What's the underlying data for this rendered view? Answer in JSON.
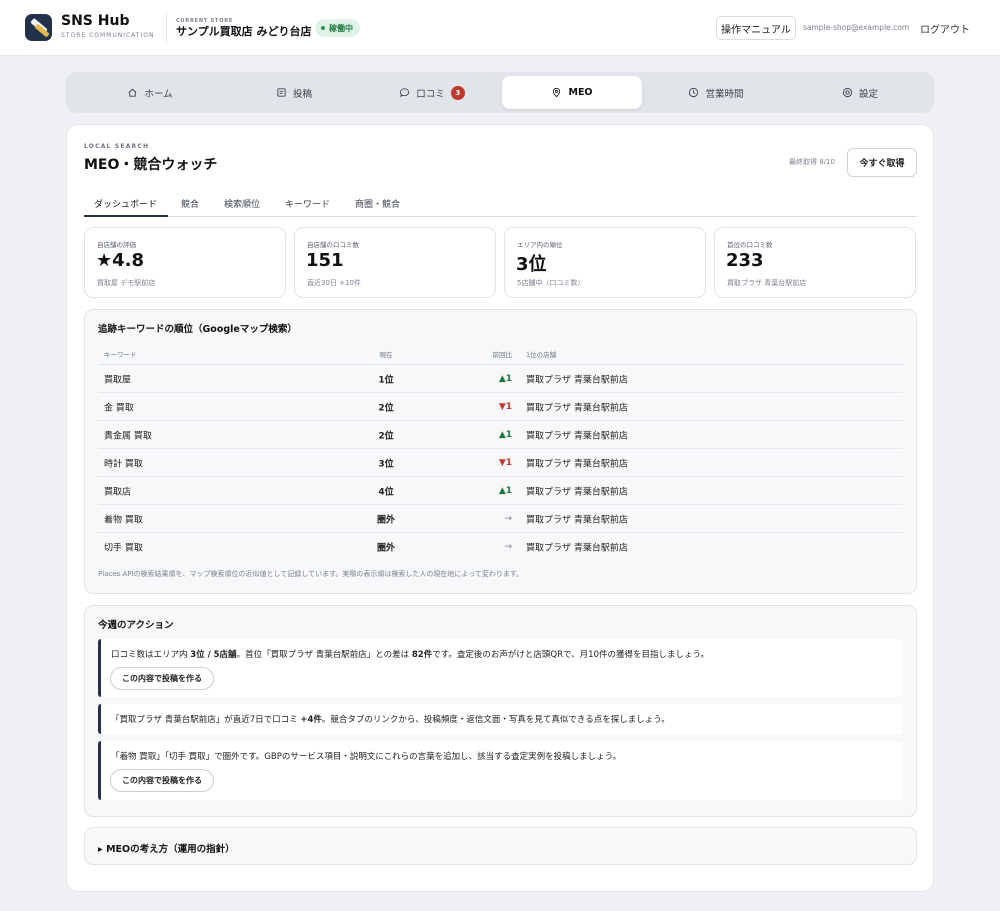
{
  "header": {
    "brand": "SNS Hub",
    "brand_sub": "STORE COMMUNICATION",
    "store_caption": "CURRENT STORE",
    "store_name": "サンプル買取店 みどり台店",
    "status_badge": "稼働中",
    "manual_label": "操作マニュアル",
    "email": "sample-shop@example.com",
    "logout_label": "ログアウト"
  },
  "nav": {
    "tabs": [
      {
        "label": "ホーム",
        "icon": "home-icon"
      },
      {
        "label": "投稿",
        "icon": "edit-icon"
      },
      {
        "label": "口コミ",
        "icon": "chat-icon",
        "badge": "3"
      },
      {
        "label": "MEO",
        "icon": "location-pin-icon",
        "active": true
      },
      {
        "label": "営業時間",
        "icon": "clock-icon"
      },
      {
        "label": "設定",
        "icon": "settings-icon"
      }
    ]
  },
  "page": {
    "eyebrow": "LOCAL SEARCH",
    "title": "MEO・競合ウォッチ",
    "last_fetch": "最終取得 8/10",
    "fetch_button": "今すぐ取得"
  },
  "subtabs": [
    "ダッシュボード",
    "競合",
    "検索順位",
    "キーワード",
    "商圏・競合"
  ],
  "stats": [
    {
      "label": "自店舗の評価",
      "value": "★4.8",
      "sub": "買取屋 デモ駅前店"
    },
    {
      "label": "自店舗の口コミ数",
      "value": "151",
      "sub": "直近30日 +10件"
    },
    {
      "label": "エリア内の順位",
      "value": "3位",
      "sub": "5店舗中（口コミ数）"
    },
    {
      "label": "首位の口コミ数",
      "value": "233",
      "sub": "買取プラザ 青葉台駅前店"
    }
  ],
  "keywords": {
    "title": "追跡キーワードの順位（Googleマップ検索）",
    "headers": {
      "keyword": "キーワード",
      "current": "現在",
      "diff": "前回比",
      "top": "1位の店舗"
    },
    "rows": [
      {
        "keyword": "買取屋",
        "rank": "1位",
        "diff": "▲1",
        "dir": "up",
        "top": "買取プラザ 青葉台駅前店"
      },
      {
        "keyword": "金 買取",
        "rank": "2位",
        "diff": "▼1",
        "dir": "down",
        "top": "買取プラザ 青葉台駅前店"
      },
      {
        "keyword": "貴金属 買取",
        "rank": "2位",
        "diff": "▲1",
        "dir": "up",
        "top": "買取プラザ 青葉台駅前店"
      },
      {
        "keyword": "時計 買取",
        "rank": "3位",
        "diff": "▼1",
        "dir": "down",
        "top": "買取プラザ 青葉台駅前店"
      },
      {
        "keyword": "買取店",
        "rank": "4位",
        "diff": "▲1",
        "dir": "up",
        "top": "買取プラザ 青葉台駅前店"
      },
      {
        "keyword": "着物 買取",
        "rank": "圏外",
        "diff": "→",
        "dir": "flat",
        "top": "買取プラザ 青葉台駅前店"
      },
      {
        "keyword": "切手 買取",
        "rank": "圏外",
        "diff": "→",
        "dir": "flat",
        "top": "買取プラザ 青葉台駅前店"
      }
    ],
    "note": "Places APIの検索結果順を、マップ検索順位の近似値として記録しています。実際の表示順は検索した人の現在地によって変わります。"
  },
  "actions": {
    "title": "今週のアクション",
    "items": [
      {
        "t1": "口コミ数はエリア内 ",
        "b1": "3位 / 5店舗",
        "t2": "。首位「買取プラザ 青葉台駅前店」との差は ",
        "b2": "82件",
        "t3": "です。査定後のお声がけと店頭QRで、月10件の獲得を目指しましょう。",
        "button": "この内容で投稿を作る"
      },
      {
        "t1": "「買取プラザ 青葉台駅前店」が直近7日で口コミ ",
        "b1": "+4件",
        "t2": "。競合タブのリンクから、投稿頻度・返信文面・写真を見て真似できる点を探しましょう。"
      },
      {
        "t1": "「着物 買取」「切手 買取」で圏外です。GBPのサービス項目・説明文にこれらの言葉を追加し、該当する査定実例を投稿しましょう。",
        "button": "この内容で投稿を作る"
      }
    ]
  },
  "guide": {
    "label": "▸ MEOの考え方（運用の指針）"
  }
}
